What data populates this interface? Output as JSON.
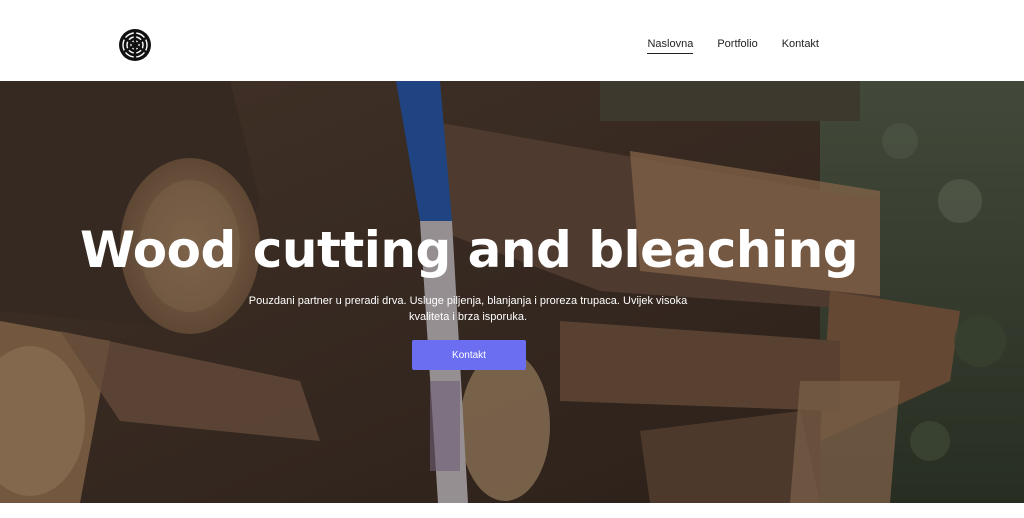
{
  "header": {
    "logo_icon": "tree-ring-logo-icon",
    "nav": [
      {
        "label": "Naslovna",
        "active": true
      },
      {
        "label": "Portfolio",
        "active": false
      },
      {
        "label": "Kontakt",
        "active": false
      }
    ]
  },
  "hero": {
    "title": "Wood cutting and bleaching",
    "subtitle": "Pouzdani partner u preradi drva. Usluge piljenja, blanjanja i proreza trupaca. Uvijek visoka kvaliteta i brza isporuka.",
    "cta_label": "Kontakt",
    "background_image": "stacked cut logs with axe handle",
    "colors": {
      "cta": "#6b6ef0",
      "text": "#ffffff"
    }
  }
}
